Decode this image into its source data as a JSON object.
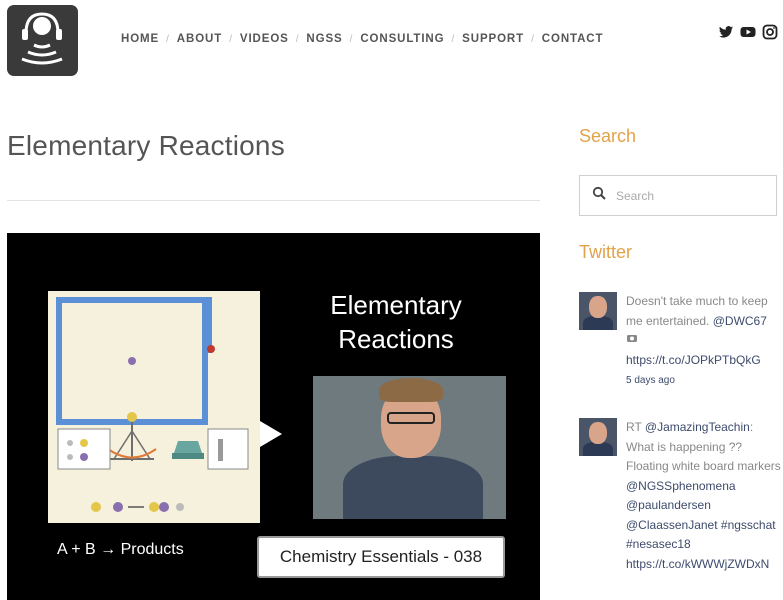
{
  "nav": {
    "items": [
      "HOME",
      "ABOUT",
      "VIDEOS",
      "NGSS",
      "CONSULTING",
      "SUPPORT",
      "CONTACT"
    ]
  },
  "social": [
    "twitter-icon",
    "youtube-icon",
    "instagram-icon"
  ],
  "page": {
    "title": "Elementary Reactions"
  },
  "video": {
    "title_line1": "Elementary",
    "title_line2": "Reactions",
    "equation": "A + B → Products",
    "badge": "Chemistry Essentials - 038"
  },
  "sidebar": {
    "search_heading": "Search",
    "search_placeholder": "Search",
    "twitter_heading": "Twitter",
    "tweets": [
      {
        "text": "Doesn't take much to keep me entertained. ",
        "mention": "@DWC67",
        "link": "https://t.co/JOPkPTbQkG",
        "time": "5 days ago"
      },
      {
        "prefix": "RT ",
        "mention": "@JamazingTeachin",
        "text": ": What is happening ?? Floating white board markers ",
        "mention2": "@NGSSphenomena",
        "mention3": "@paulandersen",
        "mention4": "@ClaassenJanet",
        "hashtags": " #ngsschat #nesasec18",
        "link": "https://t.co/kWWWjZWDxN"
      }
    ]
  },
  "colors": {
    "accent": "#e2a24a",
    "link": "#3d4b6c",
    "nav_text": "#555555"
  }
}
